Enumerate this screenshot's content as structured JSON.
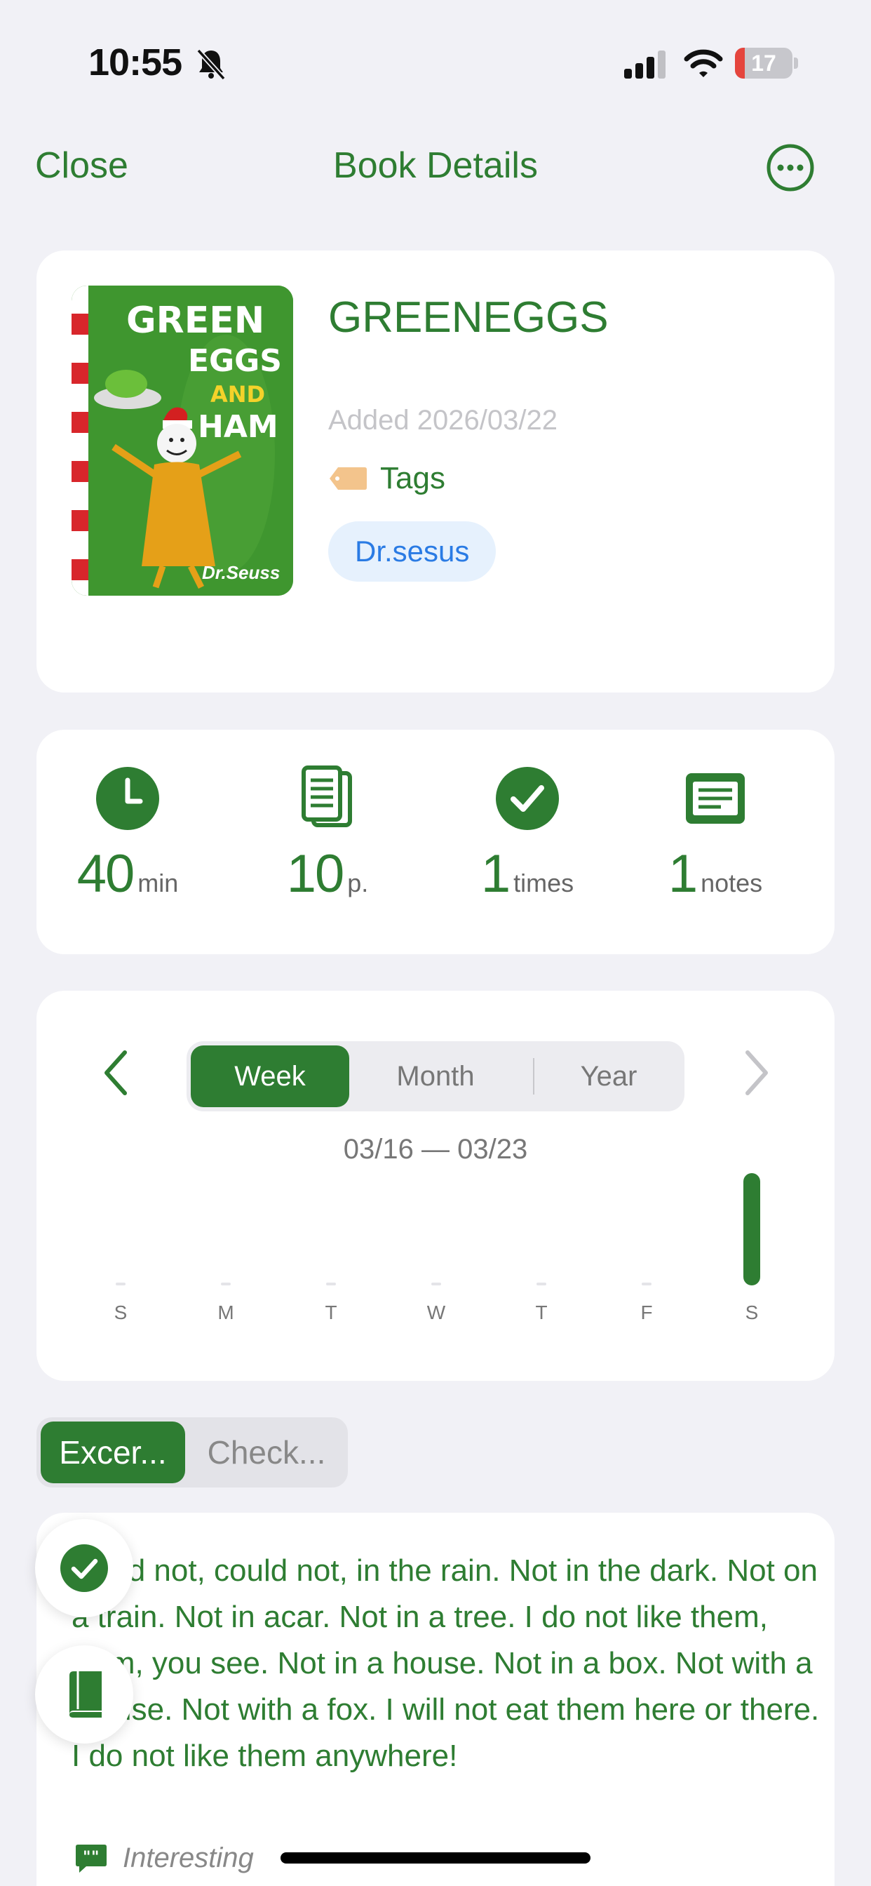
{
  "status_bar": {
    "time": "10:55",
    "battery": "17",
    "battery_level": 0.17
  },
  "nav": {
    "close_label": "Close",
    "title": "Book Details",
    "more_icon": "ellipsis-circle-icon"
  },
  "book": {
    "title": "GREENEGGS",
    "added": "Added 2026/03/22",
    "tags_label": "Tags",
    "tag": "Dr.sesus",
    "cover_text": {
      "line1": "GREEN",
      "line2": "EGGS",
      "line3": "AND",
      "line4": "HAM",
      "author": "Dr.Seuss"
    }
  },
  "stats": [
    {
      "icon": "clock-icon",
      "value": "40",
      "unit": "min"
    },
    {
      "icon": "pages-icon",
      "value": "10",
      "unit": "p."
    },
    {
      "icon": "check-circle-icon",
      "value": "1",
      "unit": "times"
    },
    {
      "icon": "notes-icon",
      "value": "1",
      "unit": "notes"
    }
  ],
  "period": {
    "tabs": [
      "Week",
      "Month",
      "Year"
    ],
    "active": "Week",
    "range": "03/16 — 03/23"
  },
  "chart_data": {
    "type": "bar",
    "categories": [
      "S",
      "M",
      "T",
      "W",
      "T",
      "F",
      "S"
    ],
    "values": [
      0,
      0,
      0,
      0,
      0,
      0,
      1
    ],
    "title": "",
    "xlabel": "",
    "ylabel": "",
    "grid": false,
    "color": "#2e7d32"
  },
  "content_tabs": {
    "items": [
      "Excer...",
      "Check..."
    ],
    "active": "Excer..."
  },
  "excerpt": {
    "text": "could not, could not, in the rain. Not in the dark. Not on a train. Not in acar. Not in a tree. I do not like them, Sam, you see. Not in a house. Not in a box. Not with a mouse. Not with a fox. I will not eat them here or there. I do not like them anywhere!",
    "note_label": "Interesting"
  },
  "colors": {
    "accent": "#2e7d32",
    "background": "#f1f1f6",
    "tag_bg": "#e6f1fd",
    "tag_text": "#2a7be4"
  }
}
